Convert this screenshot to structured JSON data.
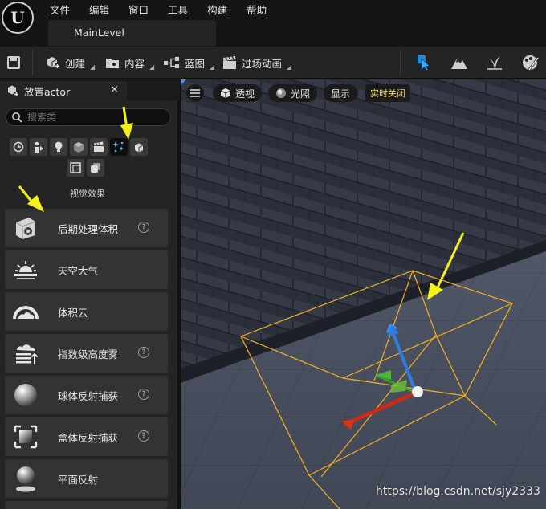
{
  "app": {
    "menus": [
      "文件",
      "编辑",
      "窗口",
      "工具",
      "构建",
      "帮助"
    ],
    "level_tab": "MainLevel"
  },
  "toolbar": {
    "create_label": "创建",
    "content_label": "内容",
    "blueprint_label": "蓝图",
    "cinematics_label": "过场动画",
    "right_icons": [
      "select-mode-icon",
      "landscape-mode-icon",
      "foliage-mode-icon",
      "mesh-paint-mode-icon"
    ]
  },
  "place_actors": {
    "tab_title": "放置actor",
    "close_glyph": "×",
    "search_placeholder": "搜索类",
    "category_row1": [
      "recent-icon",
      "basic-icon",
      "lights-icon",
      "shapes-icon",
      "cinematic-icon",
      "visual-effects-icon",
      "volumes-icon"
    ],
    "category_row2": [
      "all-classes-icon",
      "extra-icon"
    ],
    "active_category": "visual-effects-icon",
    "category_label": "视觉效果",
    "items": [
      {
        "label": "后期处理体积",
        "icon": "post-process-volume-icon",
        "help": true
      },
      {
        "label": "天空大气",
        "icon": "sky-atmosphere-icon",
        "help": false
      },
      {
        "label": "体积云",
        "icon": "volumetric-cloud-icon",
        "help": false
      },
      {
        "label": "指数级高度雾",
        "icon": "exponential-height-fog-icon",
        "help": true
      },
      {
        "label": "球体反射捕获",
        "icon": "sphere-reflection-capture-icon",
        "help": true
      },
      {
        "label": "盒体反射捕获",
        "icon": "box-reflection-capture-icon",
        "help": true
      },
      {
        "label": "平面反射",
        "icon": "planar-reflection-icon",
        "help": false
      }
    ],
    "help_glyph": "?"
  },
  "viewport": {
    "perspective_label": "透视",
    "lighting_label": "光照",
    "show_label": "显示",
    "realtime_label": "实时关闭",
    "accent_color": "#f2b01e",
    "watermark": "https://blog.csdn.net/sjy2333"
  },
  "annotations": {
    "arrow_color": "#f5f219"
  }
}
